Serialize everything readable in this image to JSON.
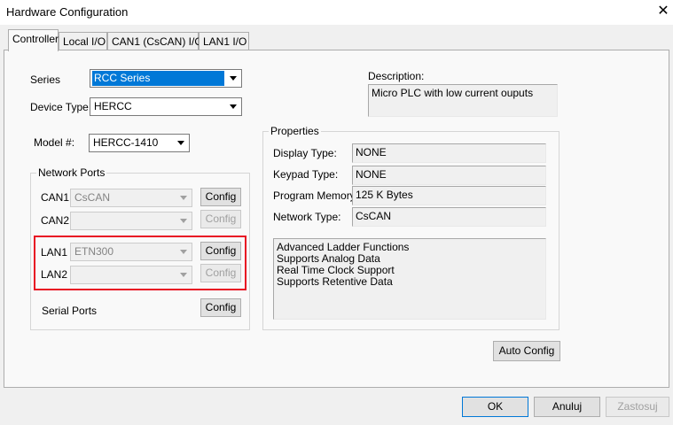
{
  "window": {
    "title": "Hardware Configuration",
    "close_glyph": "✕"
  },
  "tabs": [
    {
      "label": "Controller",
      "active": true
    },
    {
      "label": "Local I/O"
    },
    {
      "label": "CAN1 (CsCAN) I/O"
    },
    {
      "label": "LAN1 I/O"
    }
  ],
  "controller": {
    "series_label": "Series",
    "series_value": "RCC Series",
    "device_type_label": "Device Type",
    "device_type_value": "HERCC",
    "model_label": "Model #:",
    "model_value": "HERCC-1410",
    "network_ports": {
      "group_label": "Network Ports",
      "can1_label": "CAN1",
      "can1_value": "CsCAN",
      "can2_label": "CAN2",
      "can2_value": "",
      "lan1_label": "LAN1",
      "lan1_value": "ETN300",
      "lan2_label": "LAN2",
      "lan2_value": "",
      "config_label": "Config",
      "serial_ports_label": "Serial Ports"
    },
    "description_label": "Description:",
    "description_value": "Micro PLC with low current ouputs",
    "properties": {
      "group_label": "Properties",
      "display_type_label": "Display Type:",
      "display_type_value": "NONE",
      "keypad_type_label": "Keypad Type:",
      "keypad_type_value": "NONE",
      "program_memory_label": "Program Memory:",
      "program_memory_value": "125 K Bytes",
      "network_type_label": "Network Type:",
      "network_type_value": "CsCAN",
      "features": [
        "Advanced Ladder Functions",
        "Supports Analog Data",
        "Real Time Clock Support",
        "Supports Retentive Data"
      ]
    },
    "auto_config_label": "Auto Config"
  },
  "footer": {
    "ok_label": "OK",
    "cancel_label": "Anuluj",
    "apply_label": "Zastosuj"
  },
  "colors": {
    "selection": "#0078d7",
    "highlight_box": "#e81123"
  }
}
